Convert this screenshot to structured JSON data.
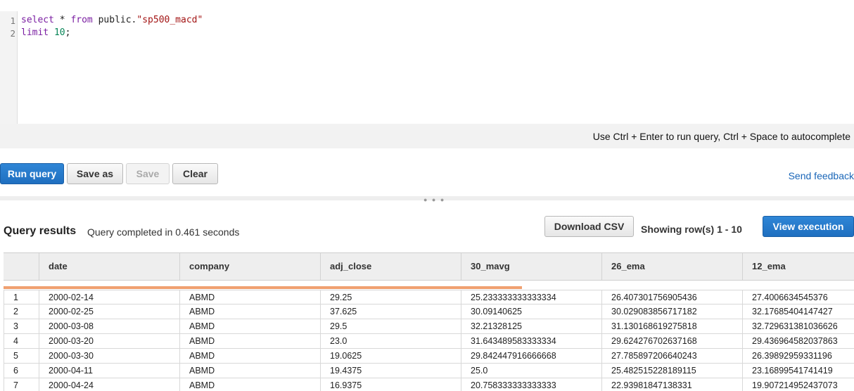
{
  "editor": {
    "lines": [
      {
        "num": "1",
        "tokens": [
          {
            "text": "select",
            "cls": "kw"
          },
          {
            "text": " * ",
            "cls": ""
          },
          {
            "text": "from",
            "cls": "kw"
          },
          {
            "text": " public.",
            "cls": ""
          },
          {
            "text": "\"sp500_macd\"",
            "cls": "str"
          }
        ]
      },
      {
        "num": "2",
        "tokens": [
          {
            "text": "limit",
            "cls": "kw"
          },
          {
            "text": " ",
            "cls": ""
          },
          {
            "text": "10",
            "cls": "num"
          },
          {
            "text": ";",
            "cls": ""
          }
        ]
      }
    ],
    "hint": "Use Ctrl + Enter to run query, Ctrl + Space to autocomplete"
  },
  "toolbar": {
    "run_label": "Run query",
    "save_as_label": "Save as",
    "save_label": "Save",
    "clear_label": "Clear",
    "feedback_label": "Send feedback"
  },
  "results": {
    "title": "Query results",
    "status": "Query completed in 0.461 seconds",
    "download_label": "Download CSV",
    "showing": "Showing row(s) 1 - 10",
    "view_execution_label": "View execution",
    "progress_fraction": 0.61,
    "columns": [
      "date",
      "company",
      "adj_close",
      "30_mavg",
      "26_ema",
      "12_ema"
    ],
    "rows": [
      [
        "1",
        "2000-02-14",
        "ABMD",
        "29.25",
        "25.233333333333334",
        "26.407301756905436",
        "27.4006634545376"
      ],
      [
        "2",
        "2000-02-25",
        "ABMD",
        "37.625",
        "30.09140625",
        "30.029083856717182",
        "32.17685404147427"
      ],
      [
        "3",
        "2000-03-08",
        "ABMD",
        "29.5",
        "32.21328125",
        "31.130168619275818",
        "32.729631381036626"
      ],
      [
        "4",
        "2000-03-20",
        "ABMD",
        "23.0",
        "31.643489583333334",
        "29.624276702637168",
        "29.436964582037863"
      ],
      [
        "5",
        "2000-03-30",
        "ABMD",
        "19.0625",
        "29.842447916666668",
        "27.785897206640243",
        "26.39892959331196"
      ],
      [
        "6",
        "2000-04-11",
        "ABMD",
        "19.4375",
        "25.0",
        "25.482515228189115",
        "23.16899541741419"
      ],
      [
        "7",
        "2000-04-24",
        "ABMD",
        "16.9375",
        "20.758333333333333",
        "22.93981847138331",
        "19.907214952437073"
      ]
    ]
  }
}
